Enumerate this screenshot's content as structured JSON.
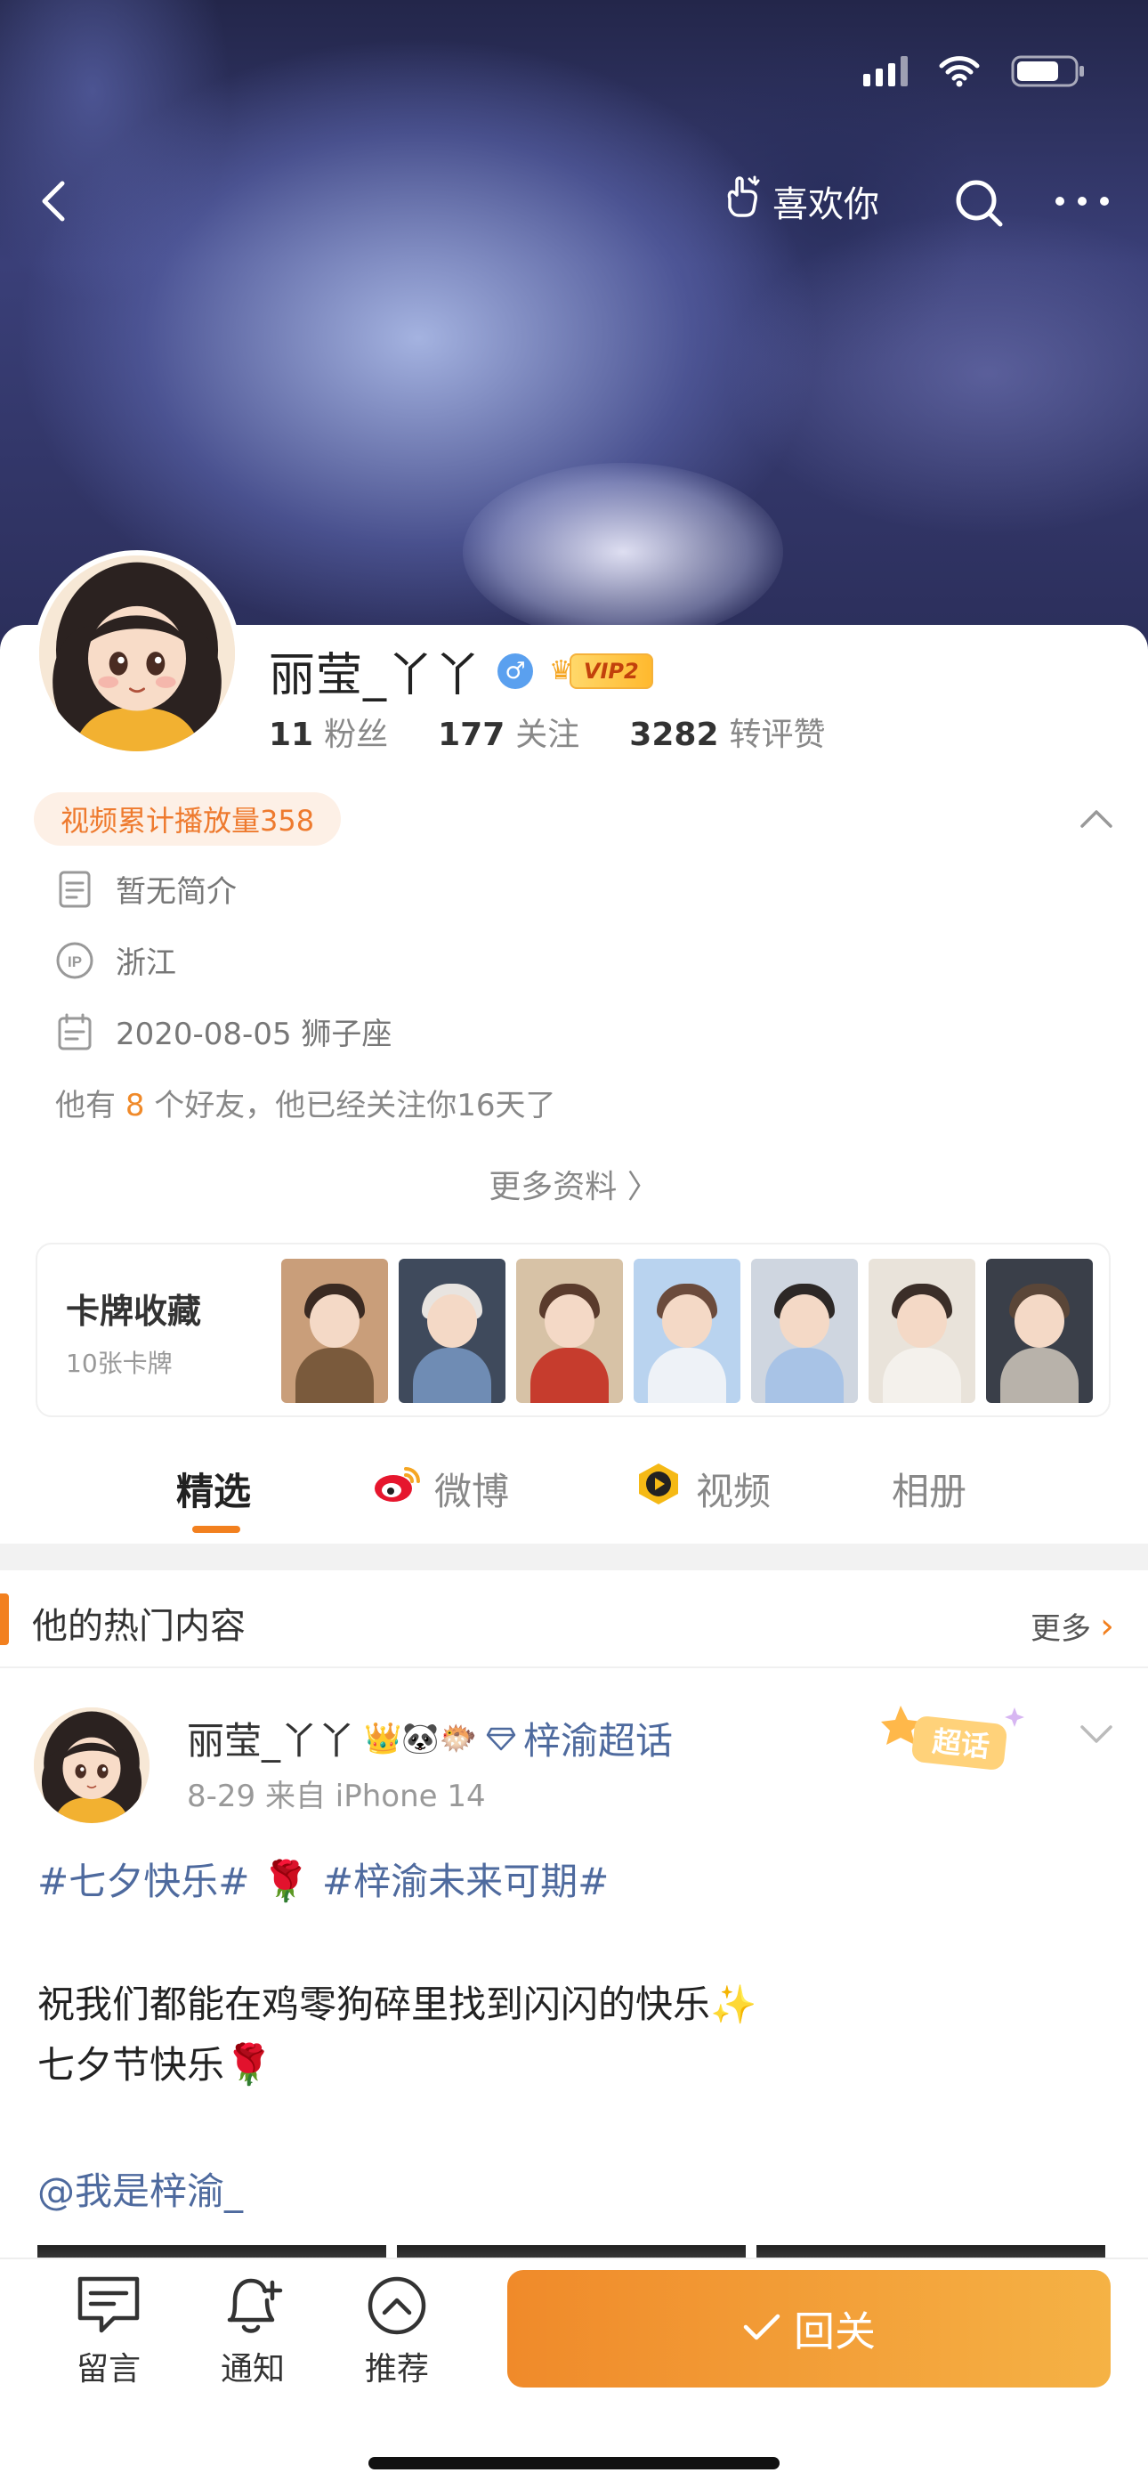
{
  "status_bar": {
    "icons": [
      "signal-icon",
      "wifi-icon",
      "battery-icon"
    ]
  },
  "nav": {
    "like_label": "喜欢你",
    "icons": [
      "back-icon",
      "like-hand-icon",
      "search-icon",
      "more-icon"
    ]
  },
  "profile": {
    "name": "丽莹_丫丫",
    "gender_symbol": "♂",
    "vip_label": "VIP2",
    "stats": [
      {
        "value": "11",
        "label": "粉丝"
      },
      {
        "value": "177",
        "label": "关注"
      },
      {
        "value": "3282",
        "label": "转评赞"
      }
    ],
    "play_count_label": "视频累计播放量358",
    "bio": "暂无简介",
    "ip_location": "浙江",
    "birthday": "2020-08-05 狮子座",
    "friends_prefix": "他有",
    "friends_count": "8",
    "friends_suffix": "个好友，他已经关注你16天了",
    "more_info_label": "更多资料 〉"
  },
  "card_collection": {
    "title": "卡牌收藏",
    "subtitle": "10张卡牌",
    "thumb_colors": [
      [
        "#c99e7a",
        "#3a2a22",
        "#7a5a3c"
      ],
      [
        "#3f4a5c",
        "#e8e4e0",
        "#6f8cb4"
      ],
      [
        "#d7c2a6",
        "#5a3b2c",
        "#c63c2d"
      ],
      [
        "#b9d3ef",
        "#6b4b3c",
        "#eef2f7"
      ],
      [
        "#cfd6e0",
        "#2d2826",
        "#a8c3e6"
      ],
      [
        "#e9e3da",
        "#3b2e28",
        "#f4f1ec"
      ],
      [
        "#3a3f49",
        "#5a4638",
        "#b8b2aa"
      ]
    ]
  },
  "tabs": [
    {
      "label": "精选",
      "icon": ""
    },
    {
      "label": "微博",
      "icon": "weibo-icon"
    },
    {
      "label": "视频",
      "icon": "video-icon"
    },
    {
      "label": "相册",
      "icon": ""
    }
  ],
  "hot_section": {
    "title": "他的热门内容",
    "more_label": "更多"
  },
  "post": {
    "author": "丽莹_丫丫",
    "badges": "👑🐼🐡",
    "topic": "梓渝超话",
    "meta": "8-29  来自 iPhone 14",
    "super_badge_label": "超话",
    "tag_line_a": "#七夕快乐#",
    "tag_line_b": "#梓渝未来可期#",
    "line_1": "祝我们都能在鸡零狗碎里找到闪闪的快乐",
    "line_2": "七夕节快乐",
    "mention": "@我是梓渝_"
  },
  "toolbar": {
    "items": [
      {
        "label": "留言",
        "icon": "message-icon"
      },
      {
        "label": "通知",
        "icon": "bell-icon"
      },
      {
        "label": "推荐",
        "icon": "recommend-icon"
      }
    ],
    "follow_label": "回关"
  },
  "colors": {
    "accent": "#f2801f",
    "link": "#4e6a9e",
    "follow_gradient_start": "#f08a2a",
    "follow_gradient_end": "#f5b245"
  }
}
